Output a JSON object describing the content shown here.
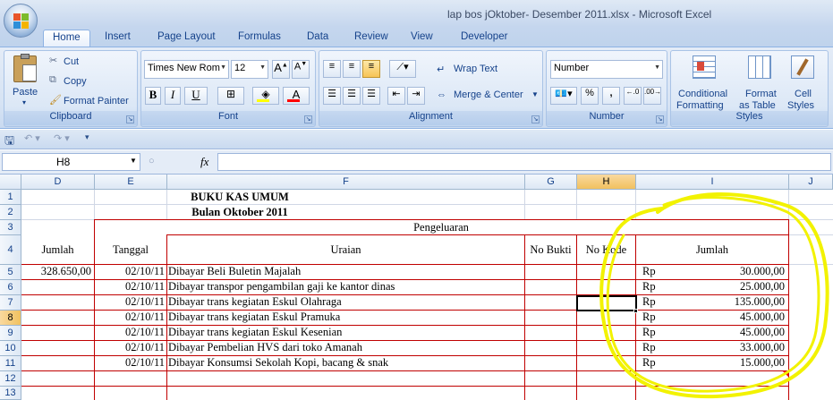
{
  "window": {
    "title": "lap bos jOktober- Desember 2011.xlsx - Microsoft Excel"
  },
  "ribbon_tabs": [
    "Home",
    "Insert",
    "Page Layout",
    "Formulas",
    "Data",
    "Review",
    "View",
    "Developer"
  ],
  "clipboard": {
    "paste": "Paste",
    "cut": "Cut",
    "copy": "Copy",
    "format_painter": "Format Painter",
    "label": "Clipboard"
  },
  "font": {
    "name": "Times New Rom",
    "size": "12",
    "label": "Font"
  },
  "alignment": {
    "wrap_text": "Wrap Text",
    "merge_center": "Merge & Center",
    "label": "Alignment"
  },
  "number": {
    "format": "Number",
    "label": "Number"
  },
  "styles": {
    "conditional": "Conditional",
    "conditional2": "Formatting",
    "format_as": "Format",
    "format_as2": "as Table",
    "cell": "Cell",
    "cell2": "Styles",
    "label": "Styles"
  },
  "formula_bar": {
    "name_box": "H8",
    "fx": "fx",
    "content": ""
  },
  "columns": [
    "D",
    "E",
    "F",
    "G",
    "H",
    "I",
    "J"
  ],
  "rows": [
    "1",
    "2",
    "3",
    "4",
    "5",
    "6",
    "7",
    "8",
    "9",
    "10",
    "11",
    "12",
    "13"
  ],
  "sheet": {
    "title1": "BUKU KAS UMUM",
    "title2": "Bulan Oktober 2011",
    "pengeluaran": "Pengeluaran",
    "hdr_jumlah_left": "Jumlah",
    "hdr_tanggal": "Tanggal",
    "hdr_uraian": "Uraian",
    "hdr_nobukti": "No Bukti",
    "hdr_nokode": "No Kode",
    "hdr_jumlah": "Jumlah",
    "first_jumlah": "328.650,00",
    "entries": [
      {
        "tanggal": "02/10/11",
        "uraian": "Dibayar Beli Buletin Majalah",
        "cur": "Rp",
        "jumlah": "30.000,00"
      },
      {
        "tanggal": "02/10/11",
        "uraian": "Dibayar transpor pengambilan gaji ke kantor dinas",
        "cur": "Rp",
        "jumlah": "25.000,00"
      },
      {
        "tanggal": "02/10/11",
        "uraian": "Dibayar trans kegiatan Eskul Olahraga",
        "cur": "Rp",
        "jumlah": "135.000,00"
      },
      {
        "tanggal": "02/10/11",
        "uraian": "Dibayar trans kegiatan Eskul Pramuka",
        "cur": "Rp",
        "jumlah": "45.000,00"
      },
      {
        "tanggal": "02/10/11",
        "uraian": "Dibayar trans kegiatan Eskul Kesenian",
        "cur": "Rp",
        "jumlah": "45.000,00"
      },
      {
        "tanggal": "02/10/11",
        "uraian": "Dibayar Pembelian HVS dari toko Amanah",
        "cur": "Rp",
        "jumlah": "33.000,00"
      },
      {
        "tanggal": "02/10/11",
        "uraian": "Dibayar Konsumsi Sekolah Kopi, bacang & snak",
        "cur": "Rp",
        "jumlah": "15.000,00"
      }
    ]
  },
  "colors": {
    "annotation": "#f2f200",
    "border_red": "#c00000",
    "selected_header": "#f1c15f"
  }
}
